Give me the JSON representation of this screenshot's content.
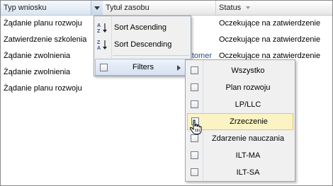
{
  "header": {
    "col1": "Typ wniosku",
    "col2": "Tytuł zasobu",
    "col3": "Status"
  },
  "rows": [
    {
      "type": "Żądanie planu rozwoju",
      "title": "",
      "status": "Oczekujące na zatwierdzenie"
    },
    {
      "type": "Zatwierdzenie szkolenia",
      "title": "",
      "status": "Oczekujące na zatwierdzenie"
    },
    {
      "type": "Żądanie zwolnienia",
      "title": "tomer",
      "status": "Oczekujące na zatwierdzenie"
    },
    {
      "type": "Żądanie zwolnienia",
      "title": "",
      "status": ""
    },
    {
      "type": "Żądanie planu rozwoju",
      "title": "",
      "status": ""
    }
  ],
  "column_menu": {
    "sort_asc": "Sort Ascending",
    "sort_desc": "Sort Descending",
    "filters": "Filters"
  },
  "filter_options": [
    "Wszystko",
    "Plan rozwoju",
    "LP/LLC",
    "Zrzeczenie",
    "Zdarzenie nauczania",
    "ILT-MA",
    "ILT-SA"
  ],
  "hovered_filter": "Zrzeczenie",
  "colors": {
    "hover_bg": "#fbf3c4",
    "menu_bg": "#f0f0f0",
    "link_text": "#2a4f8f"
  },
  "icons": {
    "sort_asc": "sort-ascending-icon",
    "sort_desc": "sort-descending-icon",
    "submenu": "chevron-right-icon",
    "cursor": "hand-pointer-icon"
  }
}
